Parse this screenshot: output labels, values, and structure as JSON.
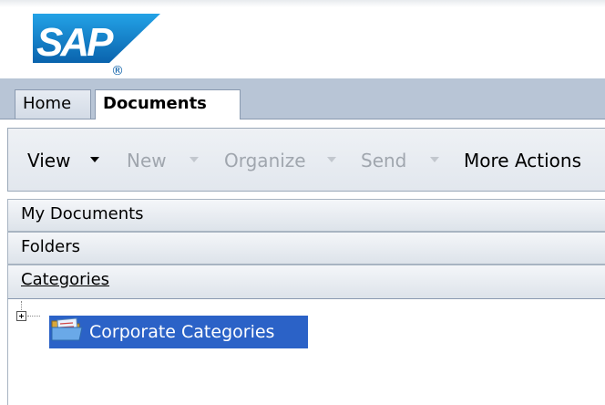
{
  "logo": {
    "text": "SAP",
    "registered_mark": "®",
    "colors": {
      "gradient_top": "#1d93dc",
      "gradient_bottom": "#0b5fa8",
      "text": "#ffffff"
    }
  },
  "tabs": [
    {
      "label": "Home",
      "active": false
    },
    {
      "label": "Documents",
      "active": true
    }
  ],
  "toolbar": {
    "items": [
      {
        "label": "View",
        "enabled": true,
        "has_dropdown": true
      },
      {
        "label": "New",
        "enabled": false,
        "has_dropdown": true
      },
      {
        "label": "Organize",
        "enabled": false,
        "has_dropdown": true
      },
      {
        "label": "Send",
        "enabled": false,
        "has_dropdown": true
      },
      {
        "label": "More Actions",
        "enabled": true,
        "has_dropdown": false
      }
    ]
  },
  "panels": {
    "my_documents": "My Documents",
    "folders": "Folders",
    "categories": "Categories"
  },
  "tree": {
    "nodes": [
      {
        "label": "Corporate Categories",
        "selected": true,
        "expander": "+",
        "icon": "folder-icon"
      }
    ]
  },
  "colors": {
    "tab_bar": "#b8c5d6",
    "selection": "#2b62c7",
    "disabled_text": "#a0a6ae"
  }
}
